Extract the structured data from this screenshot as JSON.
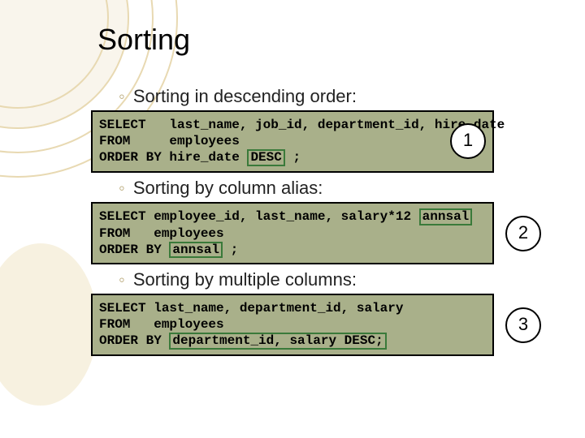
{
  "title": "Sorting",
  "bullets": {
    "b1": "Sorting in descending order:",
    "b2": "Sorting by column alias:",
    "b3": "Sorting by multiple columns:"
  },
  "code1": {
    "line1a": "SELECT   last_name, job_id, department_id, hire_date",
    "line2a": "FROM     employees",
    "line3a": "ORDER BY hire_date ",
    "desc": "DESC",
    "line3b": " ;",
    "badge": "1"
  },
  "code2": {
    "line1a": "SELECT employee_id, last_name, salary*12 ",
    "alias": "annsal",
    "line2": "FROM   employees",
    "line3a": "ORDER BY ",
    "aliasref": "annsal",
    "line3b": " ;",
    "badge": "2"
  },
  "code3": {
    "line1": "SELECT last_name, department_id, salary",
    "line2": "FROM   employees",
    "line3a": "ORDER BY ",
    "cols": "department_id, salary DESC;",
    "badge": "3"
  }
}
